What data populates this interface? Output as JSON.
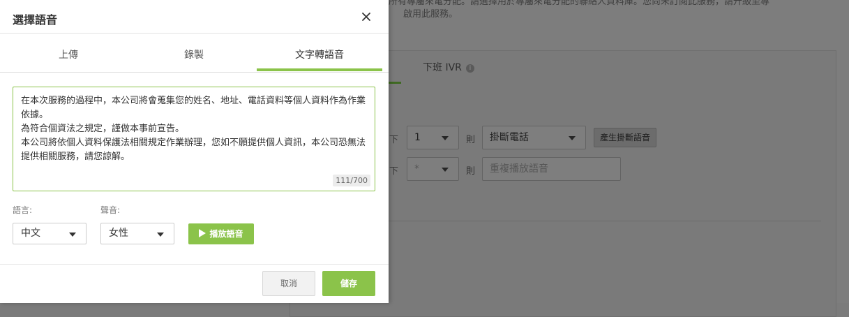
{
  "background": {
    "notice_line1": "D的所有專屬來電分配。請選擇用於專屬來電分配的聯絡人資料庫。您尚未訂閱此服務，請升級至專",
    "notice_line2": "啟用此服務。",
    "tab_after_hours_ivr": "下班 IVR",
    "rows": [
      {
        "label": "下",
        "key_value": "1",
        "then": "則",
        "action": "掛斷電話",
        "extra_button": "產生掛斷語音"
      },
      {
        "label": "下",
        "key_value": "*",
        "then": "則",
        "action": "重複播放語音"
      }
    ]
  },
  "modal": {
    "title": "選擇語音",
    "tabs": [
      {
        "label": "上傳"
      },
      {
        "label": "錄製"
      },
      {
        "label": "文字轉語音"
      }
    ],
    "active_tab": "文字轉語音",
    "tts_text": "在本次服務的過程中，本公司將會蒐集您的姓名、地址、電話資料等個人資料作為作業依據。\n為符合個資法之規定，謹做本事前宣告。\n本公司將依個人資料保護法相關規定作業辦理，您如不願提供個人資訊，本公司恐無法提供相關服務，請您諒解。",
    "char_count": "111/700",
    "language_label": "語言:",
    "language_value": "中文",
    "voice_label": "聲音:",
    "voice_value": "女性",
    "play_button": "播放語音",
    "cancel_button": "取消",
    "save_button": "儲存"
  },
  "colors": {
    "accent_green": "#8bc34a",
    "overlay_gray": "#7d7d7d"
  }
}
